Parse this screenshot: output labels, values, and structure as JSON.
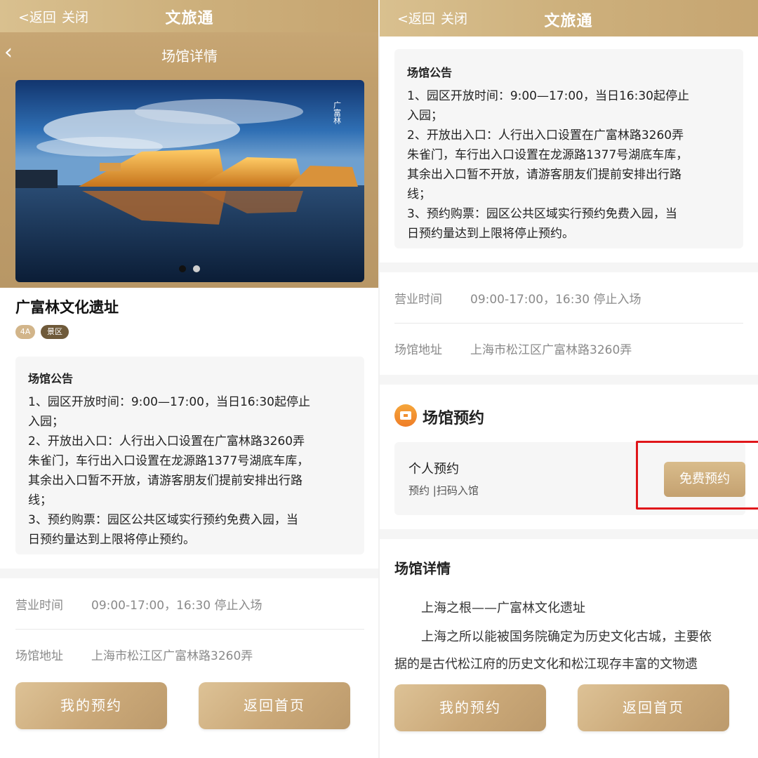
{
  "app": {
    "back_label": "<返回",
    "close_label": "关闭",
    "title": "文旅通"
  },
  "left": {
    "subbar_title": "场馆详情",
    "venue_name": "广富林文化遗址",
    "tags": [
      "4A",
      "景区"
    ],
    "hero_watermark": "广富林",
    "notice": {
      "title": "场馆公告",
      "lines": [
        "1、园区开放时间：9:00—17:00，当日16:30起停止",
        "入园；",
        "2、开放出入口：人行出入口设置在广富林路3260弄",
        "朱雀门，车行出入口设置在龙源路1377号湖底车库，",
        "其余出入口暂不开放，请游客朋友们提前安排出行路",
        "线；",
        "3、预约购票：园区公共区域实行预约免费入园，当",
        "日预约量达到上限将停止预约。"
      ]
    },
    "hours_label": "营业时间",
    "hours_value": "09:00-17:00，16:30 停止入场",
    "address_label": "场馆地址",
    "address_value": "上海市松江区广富林路3260弄",
    "my_booking": "我的预约",
    "home": "返回首页"
  },
  "right": {
    "notice": {
      "title": "场馆公告",
      "lines": [
        "1、园区开放时间：9:00—17:00，当日16:30起停止",
        "入园；",
        "2、开放出入口：人行出入口设置在广富林路3260弄",
        "朱雀门，车行出入口设置在龙源路1377号湖底车库，",
        "其余出入口暂不开放，请游客朋友们提前安排出行路",
        "线；",
        "3、预约购票：园区公共区域实行预约免费入园，当",
        "日预约量达到上限将停止预约。"
      ]
    },
    "hours_label": "营业时间",
    "hours_value": "09:00-17:00，16:30 停止入场",
    "address_label": "场馆地址",
    "address_value": "上海市松江区广富林路3260弄",
    "reserve_section_title": "场馆预约",
    "personal_title": "个人预约",
    "personal_sub": "预约 |扫码入馆",
    "free_reserve": "免费预约",
    "detail_title": "场馆详情",
    "detail_lines": [
      "上海之根——广富林文化遗址",
      "上海之所以能被国务院确定为历史文化古城，主要依",
      "据的是古代松江府的历史文化和松江现存丰富的文物遗"
    ],
    "my_booking": "我的预约",
    "home": "返回首页"
  },
  "colors": {
    "gold": "#c9a775",
    "highlight": "#e0161a",
    "orange_icon": "#f18f2f"
  }
}
